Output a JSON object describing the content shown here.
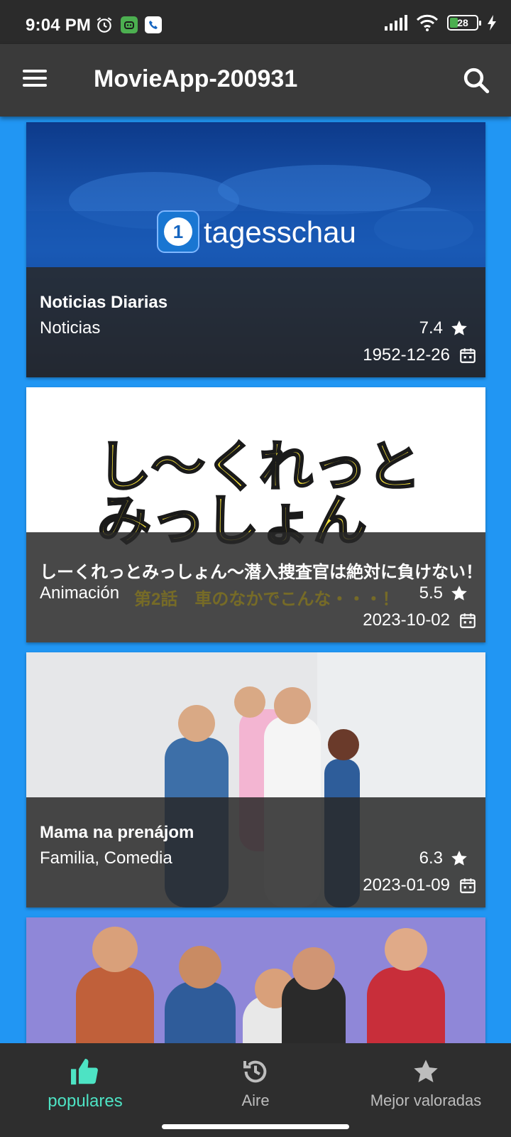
{
  "status_bar": {
    "time": "9:04 PM",
    "battery_level": "28",
    "icons": [
      "alarm-icon",
      "bot-notification-icon",
      "phone-app-icon",
      "signal-icon",
      "wifi-icon",
      "battery-icon",
      "charging-icon"
    ]
  },
  "app_bar": {
    "title": "MovieApp-200931",
    "menu_icon": "hamburger-menu-icon",
    "search_icon": "search-icon"
  },
  "movies": [
    {
      "title": "Noticias Diarias",
      "genre": "Noticias",
      "rating": "7.4",
      "date": "1952-12-26",
      "poster_text": "tagesschau"
    },
    {
      "title": "しーくれっとみっしょん〜潜入捜査官は絶対に負けない！",
      "genre": "Animación",
      "rating": "5.5",
      "date": "2023-10-02",
      "poster_text_1": "し〜くれっと",
      "poster_text_2": "みっしょん",
      "poster_subtitle": "第2話　車のなかでこんな・・・！"
    },
    {
      "title": "Mama na prenájom",
      "genre": "Familia, Comedia",
      "rating": "6.3",
      "date": "2023-01-09"
    },
    {
      "title": "",
      "genre": "",
      "rating": "",
      "date": ""
    }
  ],
  "bottom_nav": {
    "items": [
      {
        "label": "populares",
        "icon": "thumbs-up-icon",
        "active": true
      },
      {
        "label": "Aire",
        "icon": "history-clock-icon",
        "active": false
      },
      {
        "label": "Mejor valoradas",
        "icon": "star-icon",
        "active": false
      }
    ]
  },
  "colors": {
    "background": "#2196F3",
    "app_bar": "#3a3a3a",
    "status_bar": "#2b2b2b",
    "bottom_nav": "#2e2e2e",
    "active_nav": "#4de3c4"
  }
}
